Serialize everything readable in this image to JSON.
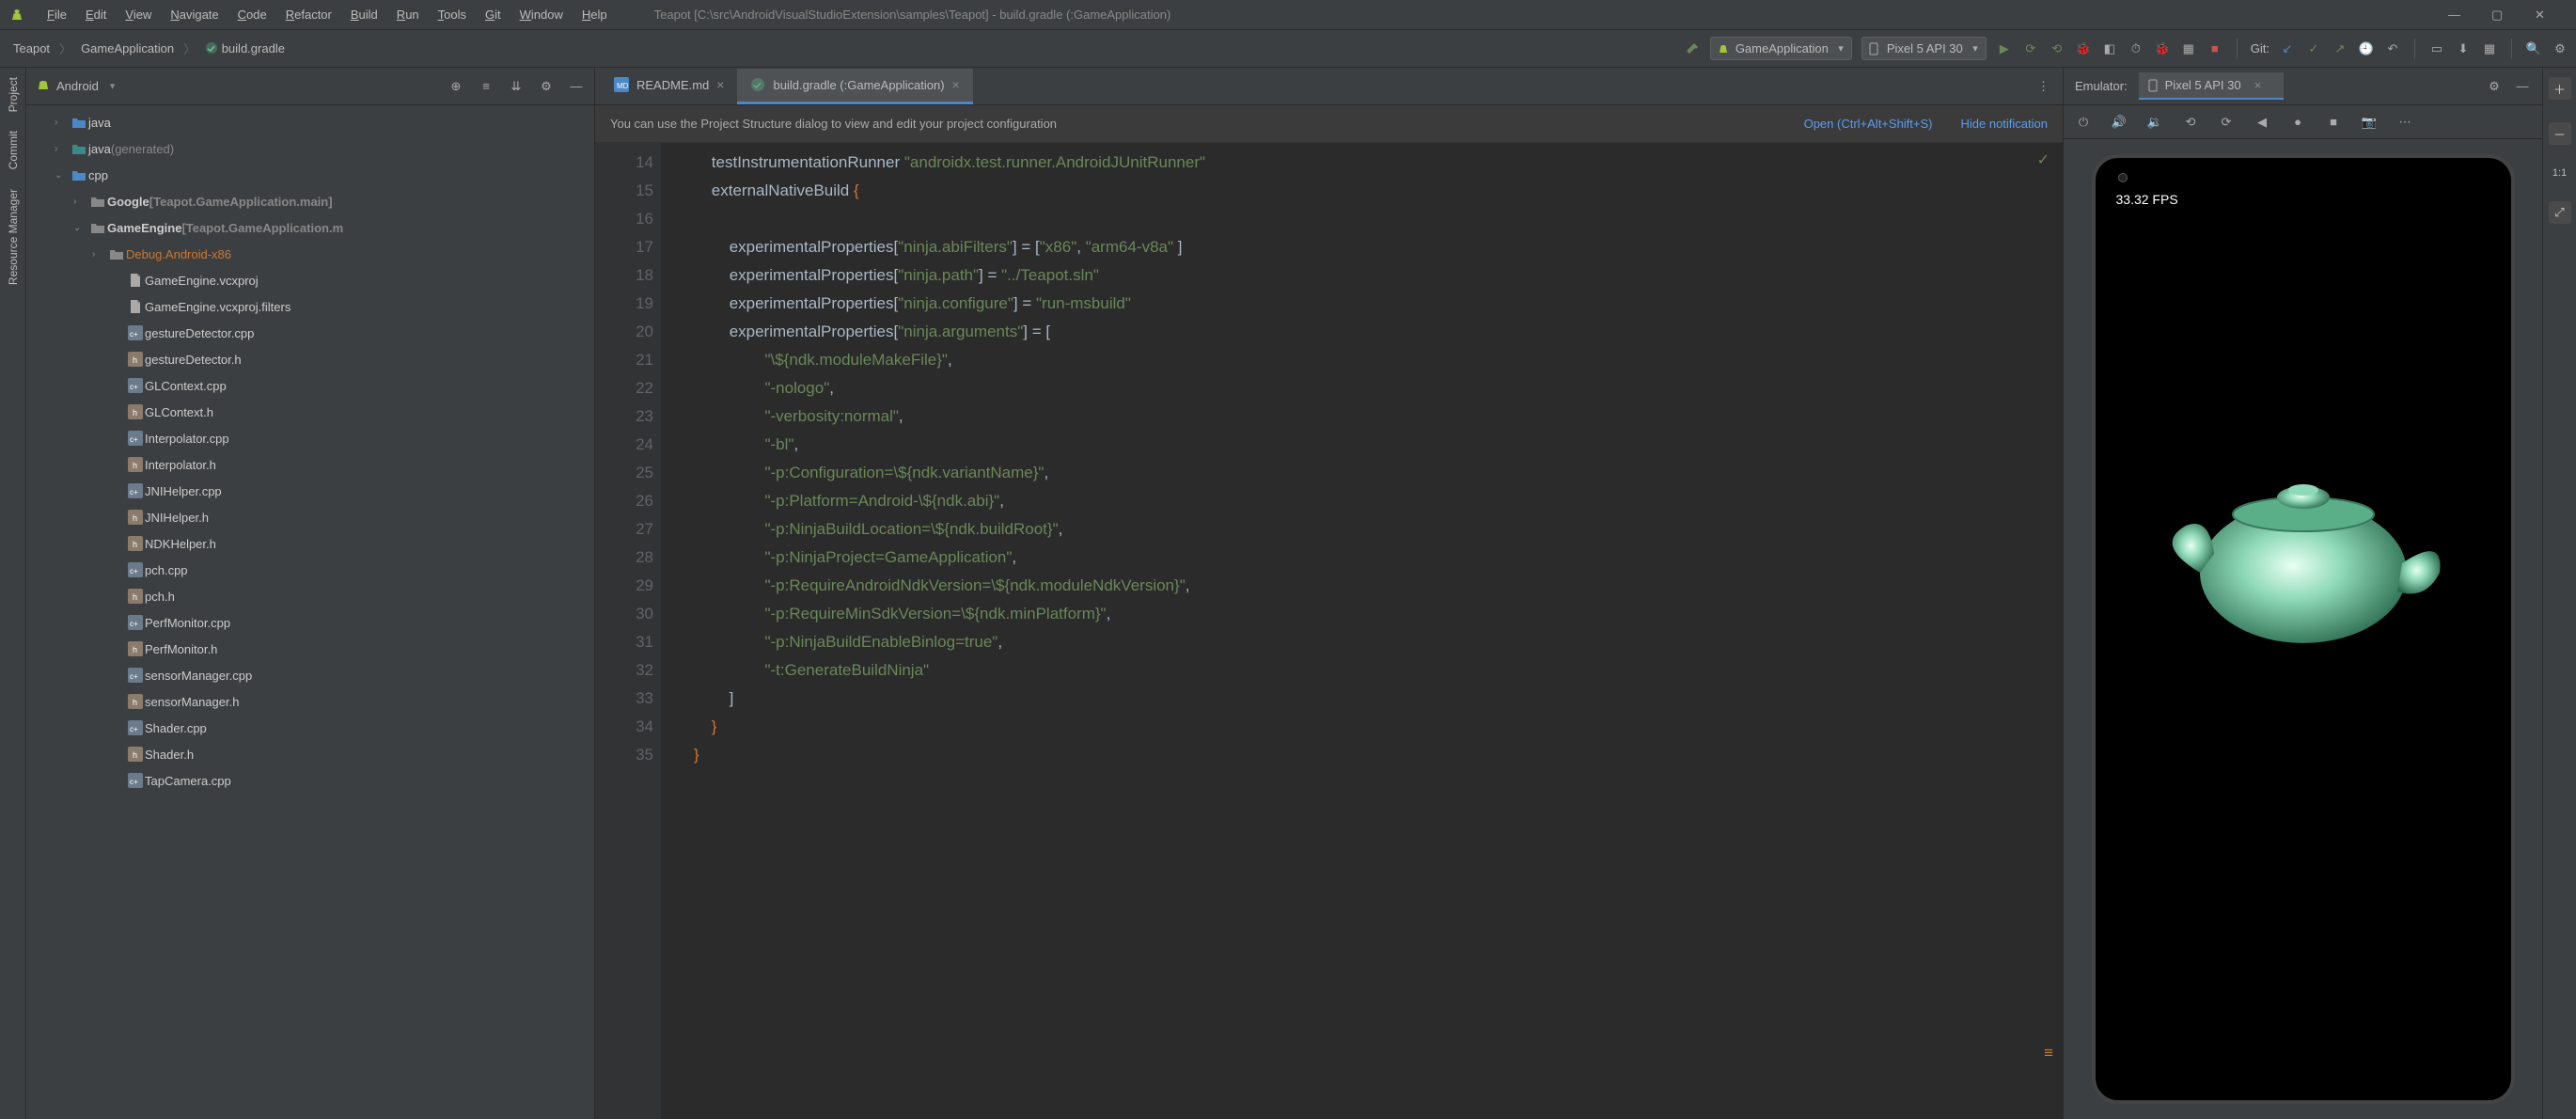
{
  "window": {
    "title": "Teapot [C:\\src\\AndroidVisualStudioExtension\\samples\\Teapot] - build.gradle (:GameApplication)"
  },
  "menu": [
    "File",
    "Edit",
    "View",
    "Navigate",
    "Code",
    "Refactor",
    "Build",
    "Run",
    "Tools",
    "Git",
    "Window",
    "Help"
  ],
  "breadcrumb": [
    "Teapot",
    "GameApplication",
    "build.gradle"
  ],
  "runconfig": "GameApplication",
  "device": "Pixel 5 API 30",
  "git_label": "Git:",
  "sidebar": {
    "selector": "Android",
    "tree": [
      {
        "ind": 1,
        "arrow": "›",
        "icon": "folder-blue",
        "label": "java"
      },
      {
        "ind": 1,
        "arrow": "›",
        "icon": "folder-teal",
        "label": "java",
        "suffix": "(generated)"
      },
      {
        "ind": 1,
        "arrow": "⌄",
        "icon": "folder-blue",
        "label": "cpp"
      },
      {
        "ind": 2,
        "arrow": "›",
        "icon": "folder-grey",
        "label": "Google",
        "suffix": "[Teapot.GameApplication.main]",
        "bold": true
      },
      {
        "ind": 2,
        "arrow": "⌄",
        "icon": "folder-grey",
        "label": "GameEngine",
        "suffix": "[Teapot.GameApplication.m",
        "bold": true
      },
      {
        "ind": 3,
        "arrow": "›",
        "icon": "folder-grey",
        "labelhl": "Debug.Android-x86"
      },
      {
        "ind": 4,
        "icon": "file",
        "label": "GameEngine.vcxproj"
      },
      {
        "ind": 4,
        "icon": "file",
        "label": "GameEngine.vcxproj.filters"
      },
      {
        "ind": 4,
        "icon": "cpp",
        "label": "gestureDetector.cpp"
      },
      {
        "ind": 4,
        "icon": "h",
        "label": "gestureDetector.h"
      },
      {
        "ind": 4,
        "icon": "cpp",
        "label": "GLContext.cpp"
      },
      {
        "ind": 4,
        "icon": "h",
        "label": "GLContext.h"
      },
      {
        "ind": 4,
        "icon": "cpp",
        "label": "Interpolator.cpp"
      },
      {
        "ind": 4,
        "icon": "h",
        "label": "Interpolator.h"
      },
      {
        "ind": 4,
        "icon": "cpp",
        "label": "JNIHelper.cpp"
      },
      {
        "ind": 4,
        "icon": "h",
        "label": "JNIHelper.h"
      },
      {
        "ind": 4,
        "icon": "h",
        "label": "NDKHelper.h"
      },
      {
        "ind": 4,
        "icon": "cpp",
        "label": "pch.cpp"
      },
      {
        "ind": 4,
        "icon": "h",
        "label": "pch.h"
      },
      {
        "ind": 4,
        "icon": "cpp",
        "label": "PerfMonitor.cpp"
      },
      {
        "ind": 4,
        "icon": "h",
        "label": "PerfMonitor.h"
      },
      {
        "ind": 4,
        "icon": "cpp",
        "label": "sensorManager.cpp"
      },
      {
        "ind": 4,
        "icon": "h",
        "label": "sensorManager.h"
      },
      {
        "ind": 4,
        "icon": "cpp",
        "label": "Shader.cpp"
      },
      {
        "ind": 4,
        "icon": "h",
        "label": "Shader.h"
      },
      {
        "ind": 4,
        "icon": "cpp",
        "label": "TapCamera.cpp"
      }
    ]
  },
  "leftrail": [
    "Project",
    "Commit",
    "Resource Manager"
  ],
  "tabs": [
    {
      "icon": "md",
      "label": "README.md",
      "active": false
    },
    {
      "icon": "gradle",
      "label": "build.gradle (:GameApplication)",
      "active": true
    }
  ],
  "banner": {
    "msg": "You can use the Project Structure dialog to view and edit your project configuration",
    "open": "Open (Ctrl+Alt+Shift+S)",
    "hide": "Hide notification"
  },
  "code": {
    "start": 14,
    "lines": [
      {
        "n": 14,
        "html": "        <span class='k'>testInstrumentationRunner</span> <span class='s'>\"androidx.test.runner.AndroidJUnitRunner\"</span>"
      },
      {
        "n": 15,
        "html": "        <span class='k'>externalNativeBuild</span> <span class='p'>{</span>"
      },
      {
        "n": 16,
        "html": ""
      },
      {
        "n": 17,
        "html": "            <span class='k'>experimentalProperties</span>[<span class='s'>\"ninja.abiFilters\"</span>] = [<span class='s'>\"x86\"</span>, <span class='s'>\"arm64-v8a\"</span> ]"
      },
      {
        "n": 18,
        "html": "            <span class='k'>experimentalProperties</span>[<span class='s'>\"ninja.path\"</span>] = <span class='s'>\"../Teapot.sln\"</span>"
      },
      {
        "n": 19,
        "html": "            <span class='k'>experimentalProperties</span>[<span class='s'>\"ninja.configure\"</span>] = <span class='s'>\"run-msbuild\"</span>"
      },
      {
        "n": 20,
        "html": "            <span class='k'>experimentalProperties</span>[<span class='s'>\"ninja.arguments\"</span>] = ["
      },
      {
        "n": 21,
        "html": "                    <span class='s'>\"\\${ndk.moduleMakeFile}\"</span>,"
      },
      {
        "n": 22,
        "html": "                    <span class='s'>\"-nologo\"</span>,"
      },
      {
        "n": 23,
        "html": "                    <span class='s'>\"-verbosity:normal\"</span>,"
      },
      {
        "n": 24,
        "html": "                    <span class='s'>\"-bl\"</span>,"
      },
      {
        "n": 25,
        "html": "                    <span class='s'>\"-p:Configuration=\\${ndk.variantName}\"</span>,"
      },
      {
        "n": 26,
        "html": "                    <span class='s'>\"-p:Platform=Android-\\${ndk.abi}\"</span>,"
      },
      {
        "n": 27,
        "html": "                    <span class='s'>\"-p:NinjaBuildLocation=\\${ndk.buildRoot}\"</span>,"
      },
      {
        "n": 28,
        "html": "                    <span class='s'>\"-p:NinjaProject=GameApplication\"</span>,"
      },
      {
        "n": 29,
        "html": "                    <span class='s'>\"-p:RequireAndroidNdkVersion=\\${ndk.moduleNdkVersion}\"</span>,"
      },
      {
        "n": 30,
        "html": "                    <span class='s'>\"-p:RequireMinSdkVersion=\\${ndk.minPlatform}\"</span>,"
      },
      {
        "n": 31,
        "html": "                    <span class='s'>\"-p:NinjaBuildEnableBinlog=true\"</span>,"
      },
      {
        "n": 32,
        "html": "                    <span class='s'>\"-t:GenerateBuildNinja\"</span>"
      },
      {
        "n": 33,
        "html": "            ]"
      },
      {
        "n": 34,
        "html": "        <span class='p'>}</span>"
      },
      {
        "n": 35,
        "html": "    <span class='p'>}</span>"
      }
    ]
  },
  "emulator": {
    "title": "Emulator:",
    "device": "Pixel 5 API 30",
    "fps": "33.32 FPS"
  },
  "rightrail": {
    "zoom": "1:1"
  }
}
